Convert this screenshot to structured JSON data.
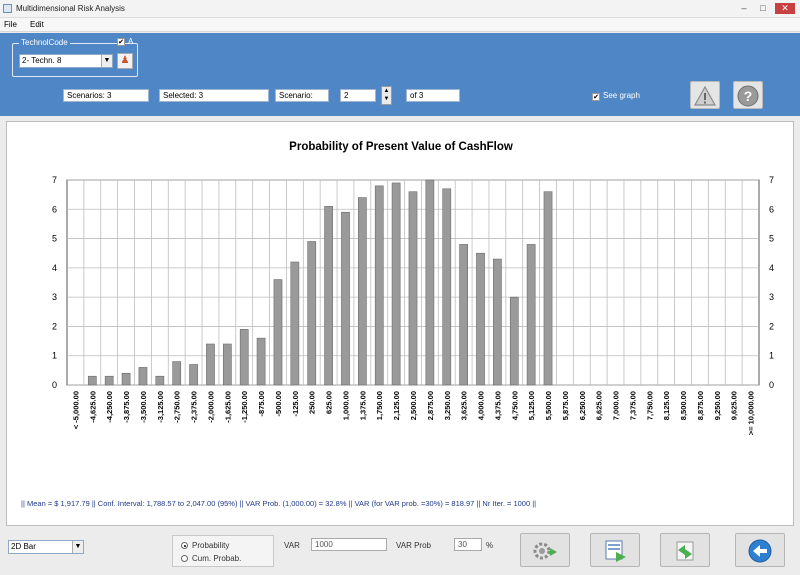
{
  "window": {
    "title": "Multidimensional Risk Analysis",
    "minimize": "–",
    "maximize": "□",
    "close": "✕"
  },
  "menu": {
    "file": "File",
    "edit": "Edit"
  },
  "toolbar": {
    "group_label": "TechnolCode",
    "group_check": "✔",
    "group_check_label": "A",
    "techn_select": "2- Techn. 8",
    "scenarios": "Scenarios: 3",
    "selected": "Selected: 3",
    "scenario_label": "Scenario:",
    "scenario_value": "2",
    "of_label": "of 3",
    "see_graph": "See graph",
    "see_graph_checked": true,
    "warning_icon": "warning-icon",
    "help_icon": "help-icon"
  },
  "chart_data": {
    "type": "bar",
    "title": "Probability of Present Value of CashFlow",
    "ylim": [
      0,
      7
    ],
    "yticks": [
      0,
      1,
      2,
      3,
      4,
      5,
      6,
      7
    ],
    "categories": [
      "< -5,000.00",
      "-4,625.00",
      "-4,250.00",
      "-3,875.00",
      "-3,500.00",
      "-3,125.00",
      "-2,750.00",
      "-2,375.00",
      "-2,000.00",
      "-1,625.00",
      "-1,250.00",
      "-875.00",
      "-500.00",
      "-125.00",
      "250.00",
      "625.00",
      "1,000.00",
      "1,375.00",
      "1,750.00",
      "2,125.00",
      "2,500.00",
      "2,875.00",
      "3,250.00",
      "3,625.00",
      "4,000.00",
      "4,375.00",
      "4,750.00",
      "5,125.00",
      "5,500.00",
      "5,875.00",
      "6,250.00",
      "6,625.00",
      "7,000.00",
      "7,375.00",
      "7,750.00",
      "8,125.00",
      "8,500.00",
      "8,875.00",
      "9,250.00",
      "9,625.00",
      ">= 10,000.00"
    ],
    "values": [
      0,
      0.3,
      0.3,
      0.4,
      0.6,
      0.3,
      0.8,
      0.7,
      1.4,
      1.4,
      1.9,
      1.6,
      3.6,
      4.2,
      4.9,
      6.1,
      5.9,
      6.4,
      6.8,
      6.9,
      6.6,
      7.0,
      6.7,
      4.8,
      4.5,
      4.3,
      3.0,
      4.8,
      6.6,
      0,
      0,
      0,
      0,
      0,
      0,
      0,
      0,
      0,
      0,
      0,
      0,
      0
    ],
    "grid": true,
    "bar_color": "#9a9a9a"
  },
  "stats": "|| Mean = $ 1,917.79 || Conf. Interval: 1,788.57 to 2,047.00 (95%) || VAR Prob. (1,000.00) = 32.8% || VAR (for VAR prob. =30%) = 818.97 || Nr Iter. = 1000 ||",
  "bottom": {
    "chart_type_select": "2D Bar",
    "radio_probability": "Probability",
    "radio_cum": "Cum. Probab.",
    "var_label": "VAR",
    "var_value": "1000",
    "var_prob_label": "VAR Prob",
    "var_prob_value": "30",
    "pct": "%"
  }
}
